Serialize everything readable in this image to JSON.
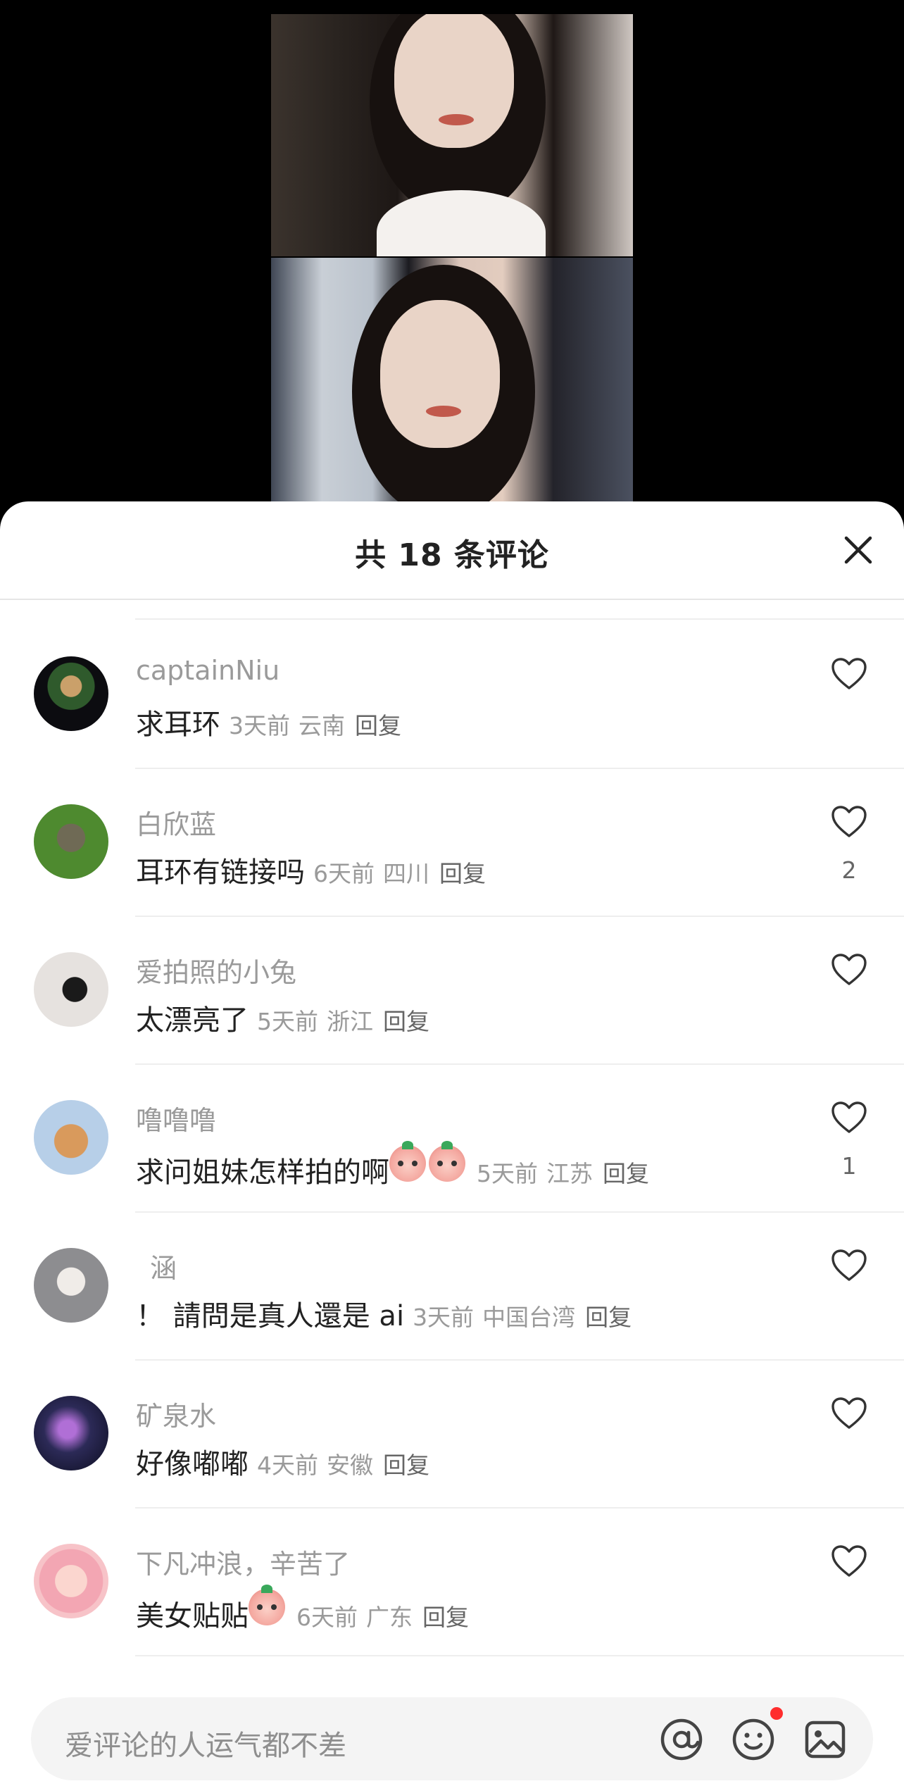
{
  "header": {
    "title": "共 18 条评论"
  },
  "comments": [
    {
      "username": "captainNiu",
      "text": "求耳环",
      "time": "3天前",
      "region": "云南",
      "reply_label": "回复",
      "likes": ""
    },
    {
      "username": "白欣蓝",
      "text": "耳环有链接吗",
      "time": "6天前",
      "region": "四川",
      "reply_label": "回复",
      "likes": "2"
    },
    {
      "username": "爱拍照的小兔",
      "text": "太漂亮了",
      "time": "5天前",
      "region": "浙江",
      "reply_label": "回复",
      "likes": ""
    },
    {
      "username": "噜噜噜",
      "text": "求问姐妹怎样拍的啊",
      "time": "5天前",
      "region": "江苏",
      "reply_label": "回复",
      "likes": "1"
    },
    {
      "username": "涵",
      "text": "！ 請問是真人還是 ai",
      "time": "3天前",
      "region": "中国台湾",
      "reply_label": "回复",
      "likes": ""
    },
    {
      "username": "矿泉水",
      "text": "好像嘟嘟",
      "time": "4天前",
      "region": "安徽",
      "reply_label": "回复",
      "likes": ""
    },
    {
      "username": "下凡冲浪，辛苦了",
      "text": "美女贴贴",
      "time": "6天前",
      "region": "广东",
      "reply_label": "回复",
      "likes": ""
    }
  ],
  "input": {
    "placeholder": "爱评论的人运气都不差"
  },
  "icons": {
    "close": "close-icon",
    "like": "heart-outline-icon",
    "mention": "at-icon",
    "emoji": "smiley-icon",
    "image": "image-icon"
  },
  "colors": {
    "notification_dot": "#ff2d2d",
    "username": "#9a9a9a",
    "text": "#222222"
  }
}
